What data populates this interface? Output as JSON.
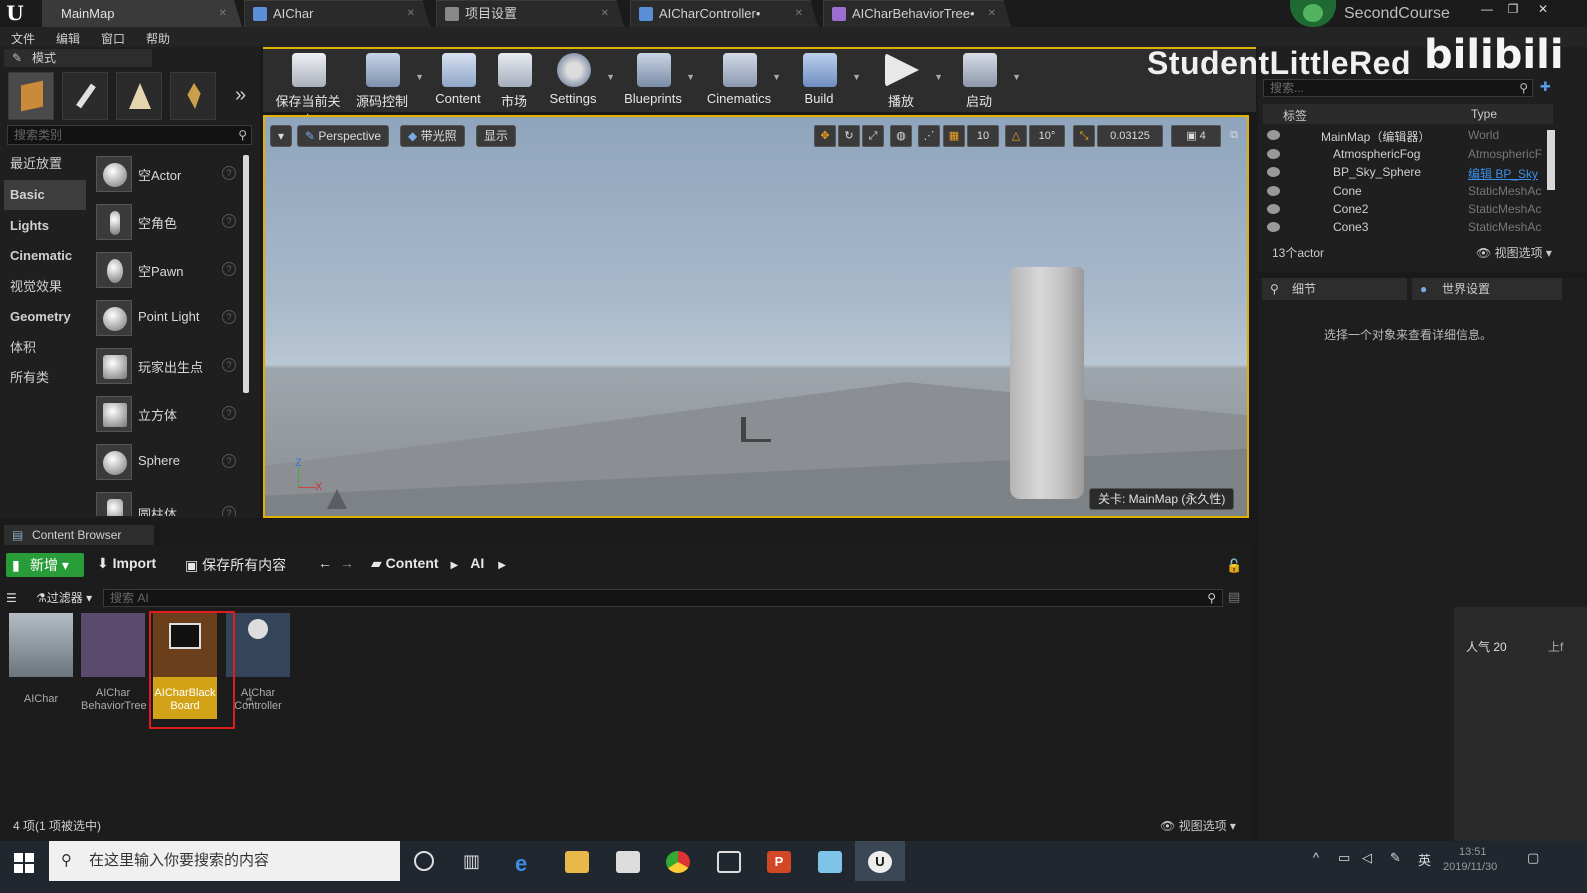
{
  "title_bar": {
    "tabs": [
      {
        "label": "MainMap"
      },
      {
        "label": "AIChar"
      },
      {
        "label": "项目设置"
      },
      {
        "label": "AICharController•"
      },
      {
        "label": "AICharBehaviorTree•"
      }
    ],
    "project_name": "SecondCourse"
  },
  "menu": [
    "文件",
    "编辑",
    "窗口",
    "帮助"
  ],
  "modes": {
    "header": "模式",
    "search_placeholder": "搜索类别",
    "categories": [
      "最近放置",
      "Basic",
      "Lights",
      "Cinematic",
      "视觉效果",
      "Geometry",
      "体积",
      "所有类"
    ],
    "selected_category": "Basic",
    "items": [
      "空Actor",
      "空角色",
      "空Pawn",
      "Point Light",
      "玩家出生点",
      "立方体",
      "Sphere",
      "圆柱体"
    ]
  },
  "toolbar": {
    "buttons": [
      {
        "label": "保存当前关卡",
        "icon": "save-icon"
      },
      {
        "label": "源码控制",
        "icon": "source-control-icon"
      },
      {
        "label": "Content",
        "icon": "content-icon"
      },
      {
        "label": "市场",
        "icon": "marketplace-icon"
      },
      {
        "label": "Settings",
        "icon": "settings-icon"
      },
      {
        "label": "Blueprints",
        "icon": "blueprints-icon"
      },
      {
        "label": "Cinematics",
        "icon": "cinematics-icon"
      },
      {
        "label": "Build",
        "icon": "build-icon"
      },
      {
        "label": "播放",
        "icon": "play-icon"
      },
      {
        "label": "启动",
        "icon": "launch-icon"
      }
    ]
  },
  "viewport": {
    "perspective": "Perspective",
    "lighting": "带光照",
    "show": "显示",
    "grid_snap": "10",
    "rot_snap": "10°",
    "scale_snap": "0.03125",
    "camera_speed": "4",
    "level_label": "关卡: MainMap (永久性)",
    "axis_z": "Z",
    "axis_x": "X"
  },
  "outliner": {
    "search_placeholder": "搜索...",
    "col_label": "标签",
    "col_type": "Type",
    "rows": [
      {
        "name": "MainMap（编辑器）",
        "type": "World"
      },
      {
        "name": "AtmosphericFog",
        "type": "AtmosphericF"
      },
      {
        "name": "BP_Sky_Sphere",
        "type": "编辑 BP_Sky"
      },
      {
        "name": "Cone",
        "type": "StaticMeshAc"
      },
      {
        "name": "Cone2",
        "type": "StaticMeshAc"
      },
      {
        "name": "Cone3",
        "type": "StaticMeshAc"
      }
    ],
    "count": "13个actor",
    "view_options": "视图选项"
  },
  "details": {
    "tab1": "细节",
    "tab2": "世界设置",
    "message": "选择一个对象来查看详细信息。"
  },
  "overlay": {
    "popularity": "人气 20",
    "upload_fragment": "上f",
    "watermark_name": "StudentLittleRed",
    "watermark_logo": "bilibili"
  },
  "content_browser": {
    "tab": "Content Browser",
    "new_button": "新增",
    "import_button": "Import",
    "save_all": "保存所有内容",
    "path": [
      "Content",
      "AI"
    ],
    "filter": "过滤器",
    "search_placeholder": "搜索 AI",
    "assets": [
      {
        "name": "AIChar"
      },
      {
        "name": "AIChar BehaviorTree"
      },
      {
        "name": "AICharBlack Board"
      },
      {
        "name": "AIChar Controller"
      }
    ],
    "status": "4 项(1 项被选中)",
    "view_options": "视图选项"
  },
  "taskbar": {
    "search_placeholder": "在这里输入你要搜索的内容",
    "ime": "英",
    "time": "13:51",
    "date": "2019/11/30"
  }
}
